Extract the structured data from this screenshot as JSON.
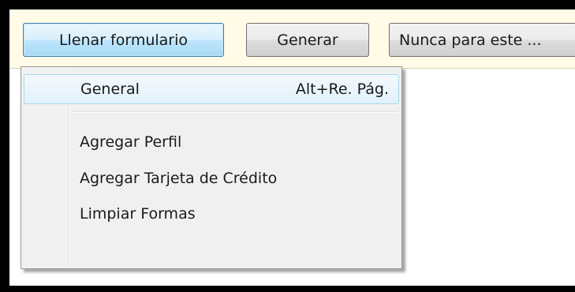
{
  "toolbar": {
    "fill_form_label": "Llenar formulario",
    "generate_label": "Generar",
    "never_label": "Nunca para este ..."
  },
  "menu": {
    "items": [
      {
        "label": "General",
        "shortcut": "Alt+Re. Pág."
      },
      {
        "label": "Agregar Perfil"
      },
      {
        "label": "Agregar Tarjeta de Crédito"
      },
      {
        "label": "Limpiar Formas"
      }
    ]
  },
  "colors": {
    "bar_background": "#fffbe6",
    "highlight": "#d9f0fc",
    "frame": "#000000"
  }
}
